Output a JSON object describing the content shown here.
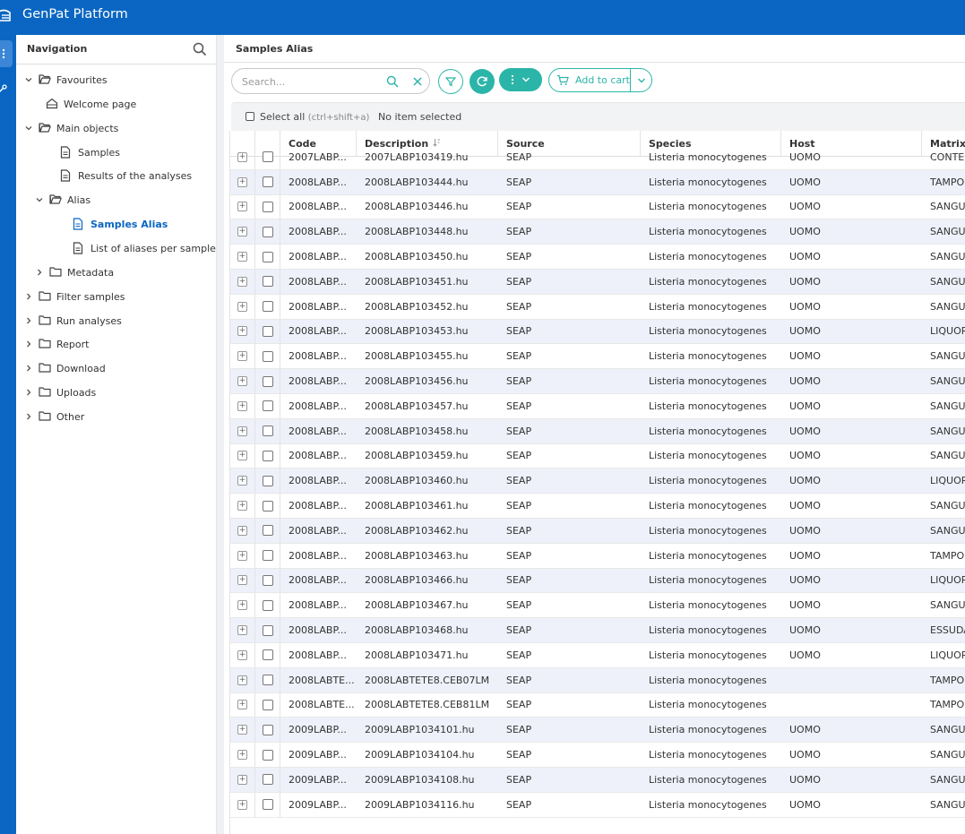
{
  "app": {
    "title": "GenPat Platform"
  },
  "nav": {
    "label": "Navigation",
    "items": [
      {
        "label": "Favourites",
        "level": 0,
        "kind": "folder-open",
        "expanded": true
      },
      {
        "label": "Welcome page",
        "level": 1,
        "kind": "home"
      },
      {
        "label": "Main objects",
        "level": 0,
        "kind": "folder-open",
        "expanded": true
      },
      {
        "label": "Samples",
        "level": 2,
        "kind": "doc"
      },
      {
        "label": "Results of the analyses",
        "level": 2,
        "kind": "doc"
      },
      {
        "label": "Alias",
        "level": 1,
        "kind": "folder-open",
        "expanded": true
      },
      {
        "label": "Samples Alias",
        "level": 3,
        "kind": "doc",
        "active": true
      },
      {
        "label": "List of aliases per sample",
        "level": 3,
        "kind": "doc"
      },
      {
        "label": "Metadata",
        "level": 1,
        "kind": "folder",
        "expanded": false
      },
      {
        "label": "Filter samples",
        "level": 0,
        "kind": "folder",
        "expanded": false
      },
      {
        "label": "Run analyses",
        "level": 0,
        "kind": "folder",
        "expanded": false
      },
      {
        "label": "Report",
        "level": 0,
        "kind": "folder",
        "expanded": false
      },
      {
        "label": "Download",
        "level": 0,
        "kind": "folder",
        "expanded": false
      },
      {
        "label": "Uploads",
        "level": 0,
        "kind": "folder",
        "expanded": false
      },
      {
        "label": "Other",
        "level": 0,
        "kind": "folder",
        "expanded": false
      }
    ]
  },
  "main": {
    "title": "Samples Alias",
    "search": {
      "placeholder": "Search..."
    },
    "add_to_cart": "Add to cart",
    "select_all": "Select all",
    "select_all_shortcut": "(ctrl+shift+a)",
    "selection_status": "No item selected"
  },
  "table": {
    "columns": [
      "Code",
      "Description",
      "Source",
      "Species",
      "Host",
      "Matrix"
    ],
    "rows": [
      [
        "2007LABP...",
        "2007LABP103419.hu",
        "SEAP",
        "Listeria monocytogenes",
        "UOMO",
        "CONTEN"
      ],
      [
        "2008LABP...",
        "2008LABP103444.hu",
        "SEAP",
        "Listeria monocytogenes",
        "UOMO",
        "TAMPO"
      ],
      [
        "2008LABP...",
        "2008LABP103446.hu",
        "SEAP",
        "Listeria monocytogenes",
        "UOMO",
        "SANGUI"
      ],
      [
        "2008LABP...",
        "2008LABP103448.hu",
        "SEAP",
        "Listeria monocytogenes",
        "UOMO",
        "SANGUI"
      ],
      [
        "2008LABP...",
        "2008LABP103450.hu",
        "SEAP",
        "Listeria monocytogenes",
        "UOMO",
        "SANGUI"
      ],
      [
        "2008LABP...",
        "2008LABP103451.hu",
        "SEAP",
        "Listeria monocytogenes",
        "UOMO",
        "SANGUI"
      ],
      [
        "2008LABP...",
        "2008LABP103452.hu",
        "SEAP",
        "Listeria monocytogenes",
        "UOMO",
        "SANGUI"
      ],
      [
        "2008LABP...",
        "2008LABP103453.hu",
        "SEAP",
        "Listeria monocytogenes",
        "UOMO",
        "LIQUOR"
      ],
      [
        "2008LABP...",
        "2008LABP103455.hu",
        "SEAP",
        "Listeria monocytogenes",
        "UOMO",
        "SANGUI"
      ],
      [
        "2008LABP...",
        "2008LABP103456.hu",
        "SEAP",
        "Listeria monocytogenes",
        "UOMO",
        "SANGUI"
      ],
      [
        "2008LABP...",
        "2008LABP103457.hu",
        "SEAP",
        "Listeria monocytogenes",
        "UOMO",
        "SANGUI"
      ],
      [
        "2008LABP...",
        "2008LABP103458.hu",
        "SEAP",
        "Listeria monocytogenes",
        "UOMO",
        "SANGUI"
      ],
      [
        "2008LABP...",
        "2008LABP103459.hu",
        "SEAP",
        "Listeria monocytogenes",
        "UOMO",
        "SANGUI"
      ],
      [
        "2008LABP...",
        "2008LABP103460.hu",
        "SEAP",
        "Listeria monocytogenes",
        "UOMO",
        "LIQUOR"
      ],
      [
        "2008LABP...",
        "2008LABP103461.hu",
        "SEAP",
        "Listeria monocytogenes",
        "UOMO",
        "SANGUI"
      ],
      [
        "2008LABP...",
        "2008LABP103462.hu",
        "SEAP",
        "Listeria monocytogenes",
        "UOMO",
        "SANGUI"
      ],
      [
        "2008LABP...",
        "2008LABP103463.hu",
        "SEAP",
        "Listeria monocytogenes",
        "UOMO",
        "TAMPO"
      ],
      [
        "2008LABP...",
        "2008LABP103466.hu",
        "SEAP",
        "Listeria monocytogenes",
        "UOMO",
        "LIQUOR"
      ],
      [
        "2008LABP...",
        "2008LABP103467.hu",
        "SEAP",
        "Listeria monocytogenes",
        "UOMO",
        "SANGUI"
      ],
      [
        "2008LABP...",
        "2008LABP103468.hu",
        "SEAP",
        "Listeria monocytogenes",
        "UOMO",
        "ESSUDA"
      ],
      [
        "2008LABP...",
        "2008LABP103471.hu",
        "SEAP",
        "Listeria monocytogenes",
        "UOMO",
        "LIQUOR"
      ],
      [
        "2008LABTE...",
        "2008LABTETE8.CEB07LM",
        "SEAP",
        "Listeria monocytogenes",
        "",
        "TAMPO"
      ],
      [
        "2008LABTE...",
        "2008LABTETE8.CEB81LM",
        "SEAP",
        "Listeria monocytogenes",
        "",
        "TAMPO"
      ],
      [
        "2009LABP...",
        "2009LABP1034101.hu",
        "SEAP",
        "Listeria monocytogenes",
        "UOMO",
        "SANGUI"
      ],
      [
        "2009LABP...",
        "2009LABP1034104.hu",
        "SEAP",
        "Listeria monocytogenes",
        "UOMO",
        "SANGUI"
      ],
      [
        "2009LABP...",
        "2009LABP1034108.hu",
        "SEAP",
        "Listeria monocytogenes",
        "UOMO",
        "SANGUI"
      ],
      [
        "2009LABP...",
        "2009LABP1034116.hu",
        "SEAP",
        "Listeria monocytogenes",
        "UOMO",
        "SANGUI"
      ]
    ]
  },
  "colors": {
    "brand": "#0a66c2",
    "accent": "#2bb5a8",
    "row_alt": "#eef1fa"
  }
}
